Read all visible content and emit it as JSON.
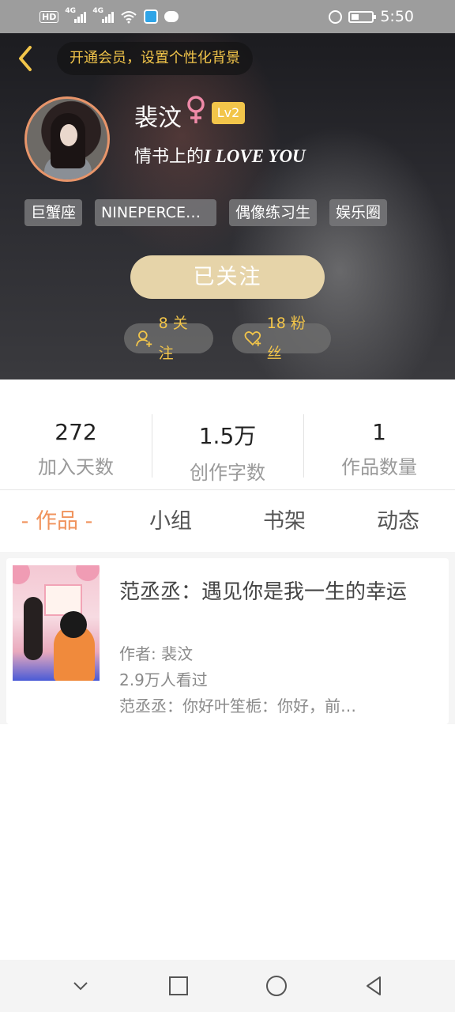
{
  "status_bar": {
    "hd": "HD",
    "sim1_network": "4G",
    "sim2_network": "4G",
    "time": "5:50",
    "icons": [
      "signal-icon",
      "wifi-icon",
      "app-notification-icon",
      "message-icon",
      "alarm-icon",
      "battery-icon"
    ]
  },
  "header": {
    "back_icon": "chevron-left-icon",
    "vip_banner": "开通会员，设置个性化背景",
    "user": {
      "name": "裴汶",
      "gender": "female",
      "level": "Lv2",
      "signature_prefix": "情书上的",
      "signature_emphasis": "I LOVE YOU"
    },
    "tags": [
      "巨蟹座",
      "NINEPERCE…",
      "偶像练习生",
      "娱乐圈"
    ],
    "follow_button": "已关注",
    "following": "8 关注",
    "fans": "18 粉丝"
  },
  "stats": [
    {
      "value": "272",
      "label": "加入天数"
    },
    {
      "value": "1.5万",
      "label": "创作字数"
    },
    {
      "value": "1",
      "label": "作品数量"
    }
  ],
  "tabs": [
    {
      "label": "- 作品 -",
      "active": true
    },
    {
      "label": "小组",
      "active": false
    },
    {
      "label": "书架",
      "active": false
    },
    {
      "label": "动态",
      "active": false
    }
  ],
  "works": [
    {
      "title": "范丞丞：遇见你是我一生的幸运",
      "author": "作者: 裴汶",
      "views": "2.9万人看过",
      "excerpt": "范丞丞：你好叶笙栀：你好，前…"
    }
  ],
  "colors": {
    "accent_orange": "#f0935d",
    "gold": "#f2c54a",
    "follow_button": "#e6d4a9",
    "avatar_border": "#e8956a"
  },
  "nav_bar": {
    "icons": [
      "hide-keyboard-icon",
      "recent-apps-icon",
      "home-icon",
      "back-icon"
    ]
  }
}
